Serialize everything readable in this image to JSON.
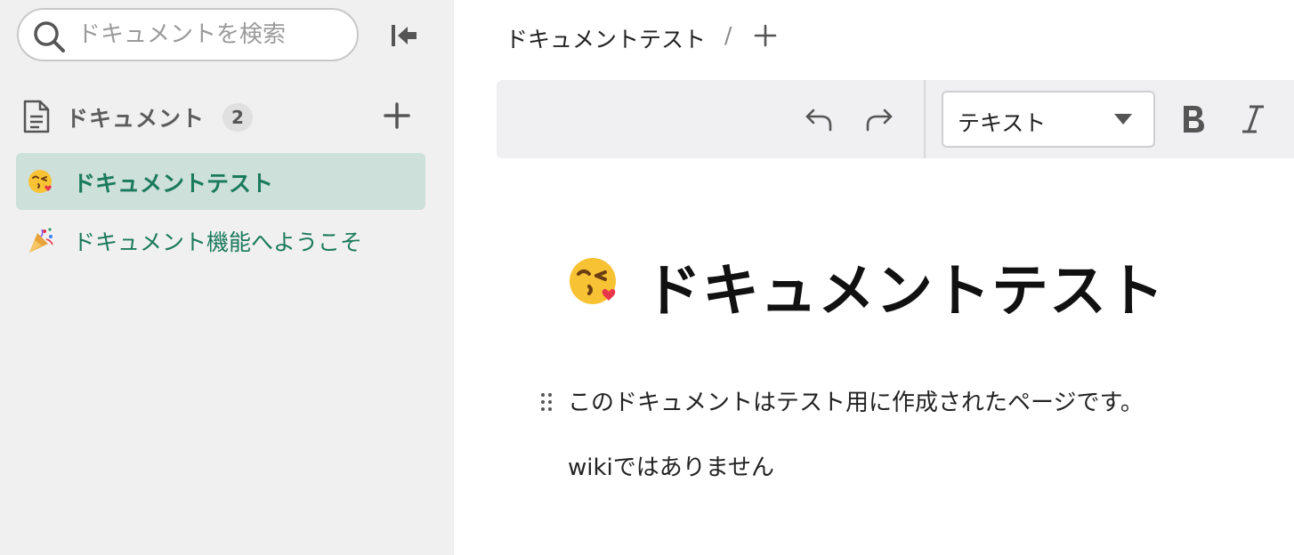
{
  "sidebar": {
    "search": {
      "placeholder": "ドキュメントを検索",
      "value": ""
    },
    "section": {
      "title": "ドキュメント",
      "count": "2"
    },
    "items": [
      {
        "emoji": "kissing-face-with-heart-icon",
        "label": "ドキュメントテスト",
        "active": true
      },
      {
        "emoji": "party-popper-icon",
        "label": "ドキュメント機能へようこそ",
        "active": false
      }
    ]
  },
  "breadcrumb": {
    "current": "ドキュメントテスト",
    "separator": "/"
  },
  "toolbar": {
    "block_type": "テキスト"
  },
  "document": {
    "emoji": "kissing-face-with-heart-icon",
    "title": "ドキュメントテスト",
    "paragraphs": [
      "このドキュメントはテスト用に作成されたページです。",
      "wikiではありません"
    ]
  },
  "colors": {
    "accent": "#1a7a5c",
    "active_item_bg": "#cde0da",
    "sidebar_bg": "#f0f0f0",
    "toolbar_bg": "#f0f0f2"
  }
}
